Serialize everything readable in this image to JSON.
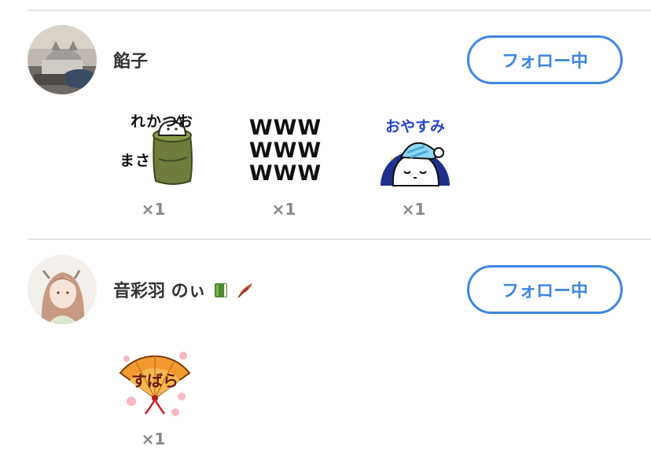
{
  "users": [
    {
      "name": "餡子",
      "follow_label": "フォロー中",
      "stickers": [
        {
          "text_lines": [
            "おつかれ",
            "さま"
          ],
          "count": "×1"
        },
        {
          "text_lines": [
            "WWW",
            "WWW",
            "WWW"
          ],
          "count": "×1"
        },
        {
          "text_lines": [
            "おやすみ"
          ],
          "count": "×1"
        }
      ]
    },
    {
      "name": "音彩羽 のぃ",
      "name_icons": [
        "green-book-icon",
        "feather-icon"
      ],
      "follow_label": "フォロー中",
      "stickers": [
        {
          "text_lines": [
            "すばら"
          ],
          "count": "×1"
        }
      ]
    }
  ],
  "colors": {
    "accent": "#3e86e0",
    "text": "#333333",
    "count": "#8a8a8a",
    "divider": "#e6e6e6"
  }
}
